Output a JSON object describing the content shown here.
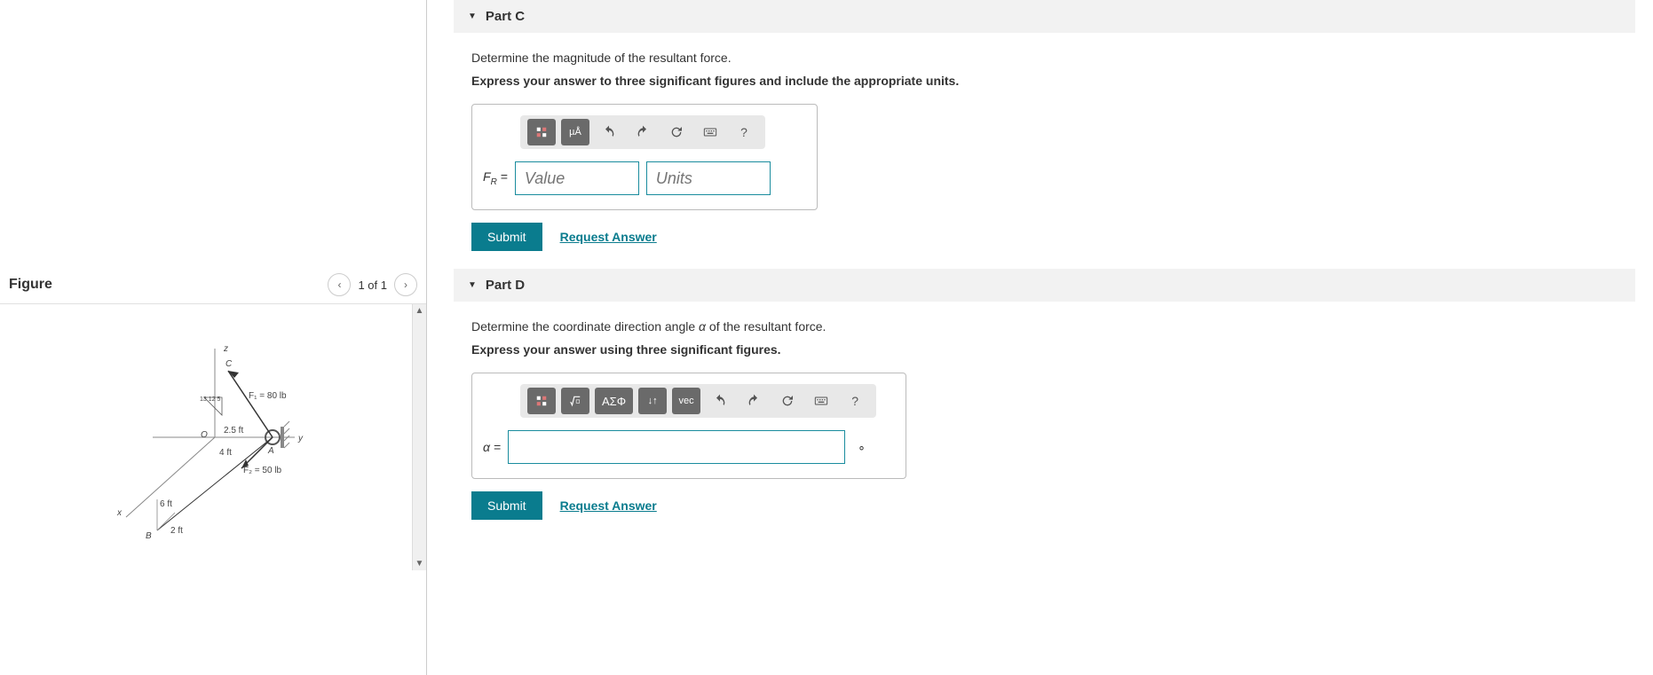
{
  "figure": {
    "title": "Figure",
    "position": "1 of 1",
    "labels": {
      "f1": "F₁ = 80 lb",
      "f2": "F₂ = 50 lb",
      "dim_25ft": "2.5 ft",
      "dim_4ft": "4 ft",
      "dim_6ft": "6 ft",
      "dim_2ft": "2 ft",
      "axis_x": "x",
      "axis_y": "y",
      "axis_z": "z",
      "point_a": "A",
      "point_b": "B",
      "point_c": "C",
      "point_o": "O",
      "slope": "13 12 5"
    }
  },
  "parts": {
    "c": {
      "header": "Part C",
      "prompt": "Determine the magnitude of the resultant force.",
      "instruction": "Express your answer to three significant figures and include the appropriate units.",
      "variable_html": "F<sub>R</sub> =",
      "value_placeholder": "Value",
      "units_placeholder": "Units",
      "toolbar": {
        "units_label": "µÅ",
        "templates": "templates"
      }
    },
    "d": {
      "header": "Part D",
      "prompt_pre": "Determine the coordinate direction angle ",
      "prompt_var": "α",
      "prompt_post": " of the resultant force.",
      "instruction": "Express your answer using three significant figures.",
      "variable_html": "α =",
      "suffix": "∘",
      "toolbar": {
        "greek_label": "ΑΣΦ",
        "vec_label": "vec",
        "updown_label": "↓↑"
      }
    }
  },
  "actions": {
    "submit": "Submit",
    "request": "Request Answer"
  },
  "tooltips": {
    "undo": "undo",
    "redo": "redo",
    "reset": "reset",
    "keyboard": "keyboard",
    "help": "?"
  }
}
